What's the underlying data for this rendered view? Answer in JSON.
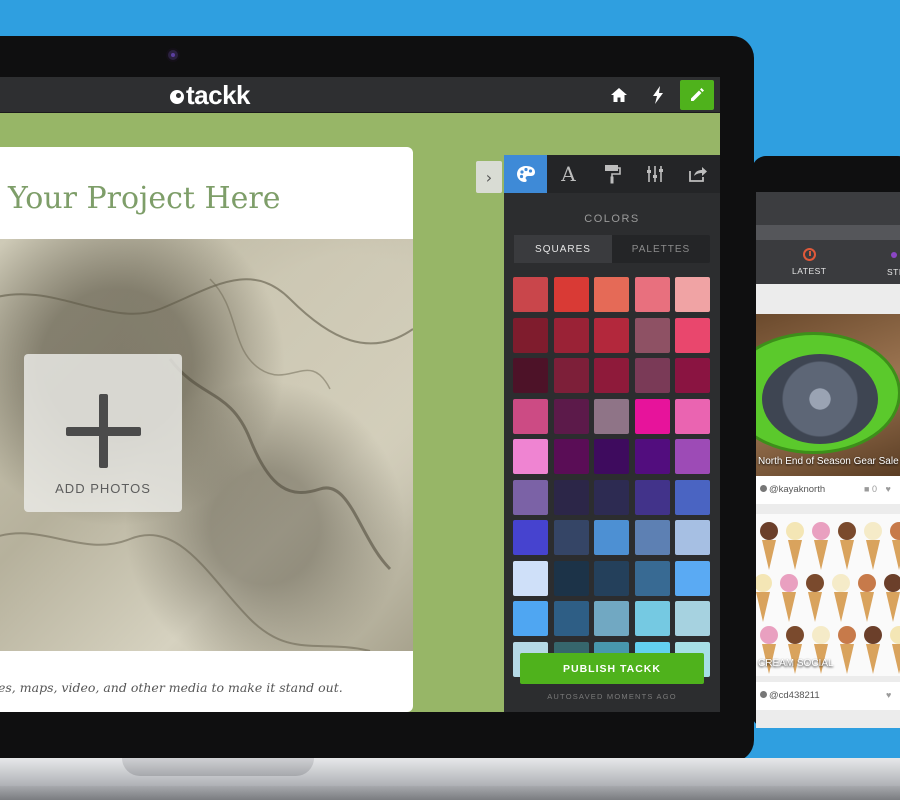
{
  "app": {
    "logo_text": "tackk"
  },
  "topbar": {
    "icons": [
      "home-icon",
      "bolt-icon",
      "pencil-icon"
    ]
  },
  "card": {
    "title": "Your Project Here",
    "add_photos_label": "ADD PHOTOS",
    "caption": "es, maps, video, and other media to make it stand out."
  },
  "panel": {
    "tabs": [
      "palette-icon",
      "font-icon",
      "paint-roller-icon",
      "sliders-icon",
      "share-icon"
    ],
    "active_tab": "palette-icon",
    "colors_title": "COLORS",
    "segments": [
      {
        "label": "SQUARES",
        "active": true
      },
      {
        "label": "PALETTES",
        "active": false
      }
    ],
    "swatches": [
      "#c9464b",
      "#d93a35",
      "#e56a57",
      "#e8707e",
      "#f0a3a4",
      "#7f1c2d",
      "#9a2236",
      "#b3283c",
      "#8e5164",
      "#e9476d",
      "#4d1228",
      "#7d1f39",
      "#8e1a3a",
      "#7a3a57",
      "#8a1441",
      "#cc4b84",
      "#5c1a4a",
      "#8f7487",
      "#e7139b",
      "#ea64b1",
      "#ef84d2",
      "#5a0d56",
      "#3e0b5e",
      "#520d7e",
      "#9d4bb6",
      "#7b62a6",
      "#2c2648",
      "#2d2b52",
      "#42338a",
      "#4a64c2",
      "#4643cf",
      "#354566",
      "#4d90d3",
      "#5d80b3",
      "#a6bfe3",
      "#cfe0f9",
      "#1c3348",
      "#24405b",
      "#386a93",
      "#5aaaf3",
      "#4fa6f2",
      "#2e5e85",
      "#71a8c2",
      "#75c9e2",
      "#a6d2e0",
      "#b6d9e6",
      "#36666c",
      "#4897ad",
      "#63d0f0",
      "#a6dfe6"
    ],
    "publish_label": "PUBLISH TACKK",
    "autosave_text": "AUTOSAVED MOMENTS AGO"
  },
  "device": {
    "tabs": [
      {
        "label": "LATEST",
        "icon": "clock-icon"
      },
      {
        "label": "STR",
        "icon": "dot-icon"
      }
    ],
    "posts": [
      {
        "caption": "North End of Season Gear Sale",
        "user": "@kayaknorth",
        "comments": "0"
      },
      {
        "caption": "CREAM SOCIAL",
        "user": "@cd438211"
      }
    ],
    "ice_cream_colors": [
      "#6b3f2a",
      "#f4e6b5",
      "#e9a0c0",
      "#7a4a2d",
      "#f5ebc8",
      "#c77a4a"
    ]
  }
}
